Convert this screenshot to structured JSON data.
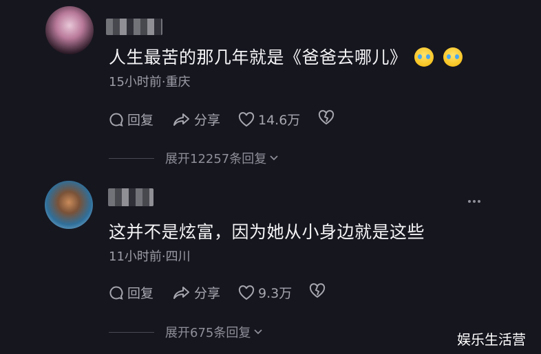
{
  "comments": [
    {
      "text": "人生最苦的那几年就是《爸爸去哪儿》",
      "emojis": [
        "crying-laughing-emoji",
        "crying-laughing-emoji"
      ],
      "meta": "15小时前·重庆",
      "reply_label": "回复",
      "share_label": "分享",
      "like_count": "14.6万",
      "expand_label": "展开12257条回复"
    },
    {
      "text": "这并不是炫富，因为她从小身边就是这些",
      "meta": "11小时前·四川",
      "reply_label": "回复",
      "share_label": "分享",
      "like_count": "9.3万",
      "expand_label": "展开675条回复"
    }
  ],
  "watermark": "娱乐生活营",
  "colors": {
    "background": "#16161f",
    "text": "#f4f4f6",
    "secondary": "#9c9ca6"
  }
}
